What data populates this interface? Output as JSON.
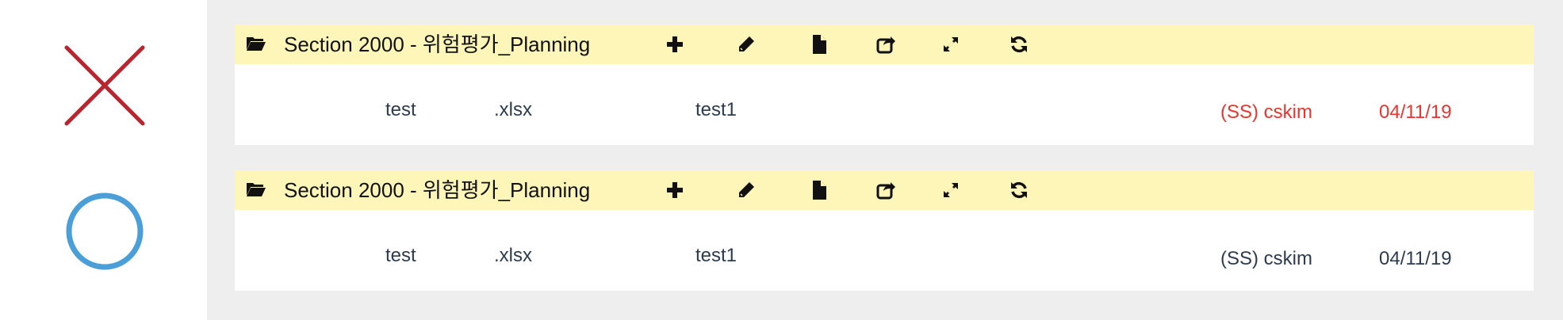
{
  "colors": {
    "header_bg": "#fdf6b8",
    "panel_bg": "#eeeeee",
    "wrong_mark": "#b8252c",
    "right_mark": "#4a9fd8",
    "alert_text": "#e8352e",
    "normal_text": "#2c3b4f"
  },
  "markers": [
    {
      "icon": "x-mark-icon",
      "meaning": ""
    },
    {
      "icon": "circle-mark-icon",
      "meaning": ""
    }
  ],
  "cards": [
    {
      "section_title": "Section 2000 - 위험평가_Planning",
      "toolbar_icons": [
        "folder-open-icon",
        "plus-icon",
        "pencil-icon",
        "file-icon",
        "share-icon",
        "expand-icon",
        "refresh-icon"
      ],
      "row": {
        "name": "test",
        "ext": ".xlsx",
        "description": "test1",
        "owner": "(SS) cskim",
        "date": "04/11/19",
        "meta_color": "#e8352e"
      }
    },
    {
      "section_title": "Section 2000 - 위험평가_Planning",
      "toolbar_icons": [
        "folder-open-icon",
        "plus-icon",
        "pencil-icon",
        "file-icon",
        "share-icon",
        "expand-icon",
        "refresh-icon"
      ],
      "row": {
        "name": "test",
        "ext": ".xlsx",
        "description": "test1",
        "owner": "(SS) cskim",
        "date": "04/11/19",
        "meta_color": "#2c3b4f"
      }
    }
  ]
}
